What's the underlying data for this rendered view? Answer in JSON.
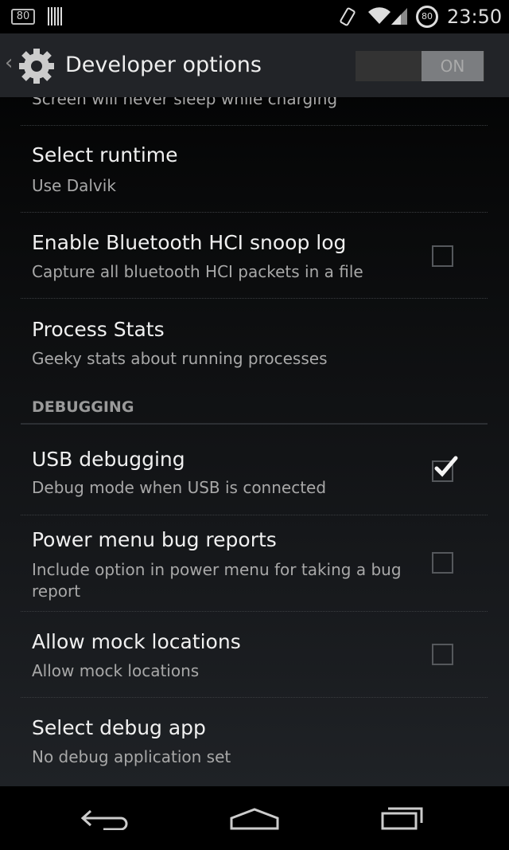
{
  "status_bar": {
    "left_badge": "80",
    "battery_level": "80",
    "time": "23:50",
    "icons": [
      "notification-80-icon",
      "barcode-icon",
      "screen-rotation-icon",
      "wifi-icon",
      "signal-icon",
      "battery-circle-icon"
    ]
  },
  "action_bar": {
    "title": "Developer options",
    "toggle": "ON",
    "icons": [
      "back-caret-icon",
      "gear-icon"
    ]
  },
  "items": [
    {
      "summary": "Screen will never sleep while charging"
    },
    {
      "title": "Select runtime",
      "summary": "Use Dalvik"
    },
    {
      "title": "Enable Bluetooth HCI snoop log",
      "summary": "Capture all bluetooth HCI packets in a file",
      "checked": false
    },
    {
      "title": "Process Stats",
      "summary": "Geeky stats about running processes"
    },
    {
      "header": "DEBUGGING"
    },
    {
      "title": "USB debugging",
      "summary": "Debug mode when USB is connected",
      "checked": true
    },
    {
      "title": "Power menu bug reports",
      "summary": "Include option in power menu for taking a bug report",
      "checked": false
    },
    {
      "title": "Allow mock locations",
      "summary": "Allow mock locations",
      "checked": false
    },
    {
      "title": "Select debug app",
      "summary": "No debug application set"
    }
  ],
  "nav_bar": {
    "icons": [
      "back-icon",
      "home-icon",
      "recents-icon"
    ]
  }
}
